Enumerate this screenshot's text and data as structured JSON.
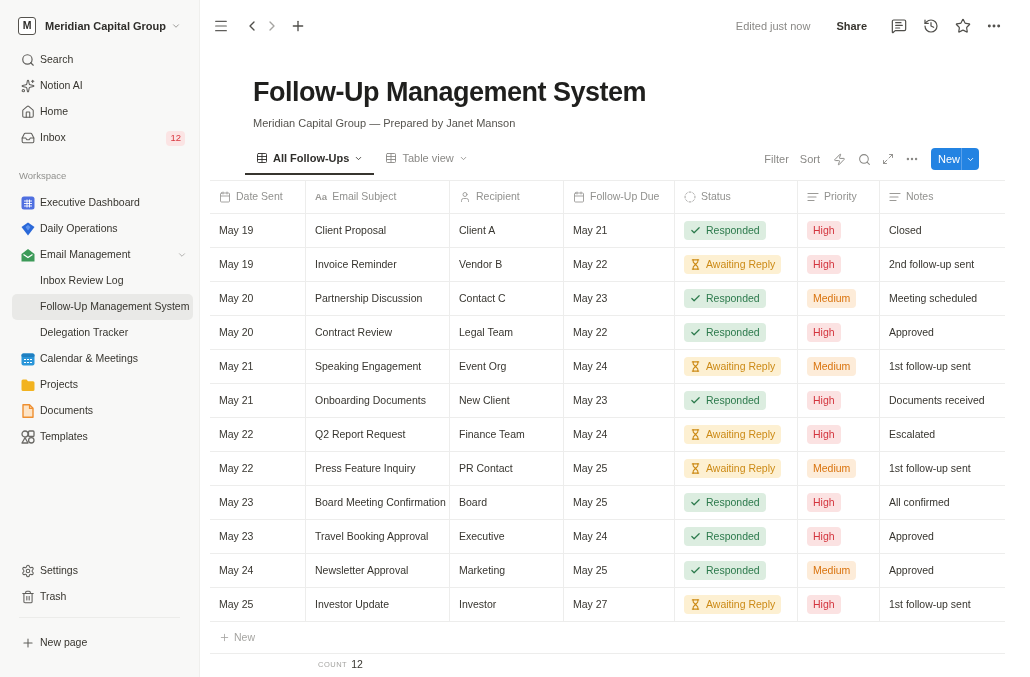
{
  "sidebar": {
    "workspace": {
      "initial": "M",
      "name": "Meridian Capital Group"
    },
    "nav": [
      {
        "label": "Search"
      },
      {
        "label": "Notion AI"
      },
      {
        "label": "Home"
      },
      {
        "label": "Inbox",
        "badge": "12"
      }
    ],
    "section_label": "Workspace",
    "pages": [
      {
        "label": "Executive Dashboard",
        "selected": false
      },
      {
        "label": "Daily Operations",
        "selected": false
      },
      {
        "label": "Email Management",
        "selected": false,
        "expanded": true,
        "children": [
          {
            "label": "Inbox Review Log",
            "selected": false
          },
          {
            "label": "Follow-Up Management System",
            "selected": true
          },
          {
            "label": "Delegation Tracker",
            "selected": false
          }
        ]
      },
      {
        "label": "Calendar & Meetings",
        "selected": false
      },
      {
        "label": "Projects",
        "selected": false
      },
      {
        "label": "Documents",
        "selected": false
      },
      {
        "label": "Templates",
        "selected": false
      }
    ],
    "footer": [
      {
        "label": "Settings"
      },
      {
        "label": "Trash"
      }
    ],
    "new_page": "New page"
  },
  "topbar": {
    "status": "Edited just now",
    "share": "Share"
  },
  "page": {
    "title": "Follow-Up Management System",
    "subtitle": "Meridian Capital Group — Prepared by Janet Manson"
  },
  "views": [
    {
      "label": "All Follow-Ups",
      "selected": true
    },
    {
      "label": "Table view",
      "selected": false
    }
  ],
  "toolbar": {
    "filter": "Filter",
    "sort": "Sort",
    "new_button": "New"
  },
  "table": {
    "columns": [
      {
        "label": "Date Sent"
      },
      {
        "label": "Email Subject",
        "glyph": "Aa"
      },
      {
        "label": "Recipient"
      },
      {
        "label": "Follow-Up Due"
      },
      {
        "label": "Status"
      },
      {
        "label": "Priority"
      },
      {
        "label": "Notes"
      }
    ],
    "rows": [
      {
        "date_sent": "May 19",
        "email_subject": "Client Proposal",
        "recipient": "Client A",
        "follow_up_due": "May 21",
        "status": {
          "label": "Responded",
          "kind": "responded"
        },
        "priority": {
          "label": "High",
          "kind": "high"
        },
        "notes": "Closed"
      },
      {
        "date_sent": "May 19",
        "email_subject": "Invoice Reminder",
        "recipient": "Vendor B",
        "follow_up_due": "May 22",
        "status": {
          "label": "Awaiting Reply",
          "kind": "awaiting"
        },
        "priority": {
          "label": "High",
          "kind": "high"
        },
        "notes": "2nd follow-up sent"
      },
      {
        "date_sent": "May 20",
        "email_subject": "Partnership Discussion",
        "recipient": "Contact C",
        "follow_up_due": "May 23",
        "status": {
          "label": "Responded",
          "kind": "responded"
        },
        "priority": {
          "label": "Medium",
          "kind": "medium"
        },
        "notes": "Meeting scheduled"
      },
      {
        "date_sent": "May 20",
        "email_subject": "Contract Review",
        "recipient": "Legal Team",
        "follow_up_due": "May 22",
        "status": {
          "label": "Responded",
          "kind": "responded"
        },
        "priority": {
          "label": "High",
          "kind": "high"
        },
        "notes": "Approved"
      },
      {
        "date_sent": "May 21",
        "email_subject": "Speaking Engagement",
        "recipient": "Event Org",
        "follow_up_due": "May 24",
        "status": {
          "label": "Awaiting Reply",
          "kind": "awaiting"
        },
        "priority": {
          "label": "Medium",
          "kind": "medium"
        },
        "notes": "1st follow-up sent"
      },
      {
        "date_sent": "May 21",
        "email_subject": "Onboarding Documents",
        "recipient": "New Client",
        "follow_up_due": "May 23",
        "status": {
          "label": "Responded",
          "kind": "responded"
        },
        "priority": {
          "label": "High",
          "kind": "high"
        },
        "notes": "Documents received"
      },
      {
        "date_sent": "May 22",
        "email_subject": "Q2 Report Request",
        "recipient": "Finance Team",
        "follow_up_due": "May 24",
        "status": {
          "label": "Awaiting Reply",
          "kind": "awaiting"
        },
        "priority": {
          "label": "High",
          "kind": "high"
        },
        "notes": "Escalated"
      },
      {
        "date_sent": "May 22",
        "email_subject": "Press Feature Inquiry",
        "recipient": "PR Contact",
        "follow_up_due": "May 25",
        "status": {
          "label": "Awaiting Reply",
          "kind": "awaiting"
        },
        "priority": {
          "label": "Medium",
          "kind": "medium"
        },
        "notes": "1st follow-up sent"
      },
      {
        "date_sent": "May 23",
        "email_subject": "Board Meeting Confirmation",
        "recipient": "Board",
        "follow_up_due": "May 25",
        "status": {
          "label": "Responded",
          "kind": "responded"
        },
        "priority": {
          "label": "High",
          "kind": "high"
        },
        "notes": "All confirmed"
      },
      {
        "date_sent": "May 23",
        "email_subject": "Travel Booking Approval",
        "recipient": "Executive",
        "follow_up_due": "May 24",
        "status": {
          "label": "Responded",
          "kind": "responded"
        },
        "priority": {
          "label": "High",
          "kind": "high"
        },
        "notes": "Approved"
      },
      {
        "date_sent": "May 24",
        "email_subject": "Newsletter Approval",
        "recipient": "Marketing",
        "follow_up_due": "May 25",
        "status": {
          "label": "Responded",
          "kind": "responded"
        },
        "priority": {
          "label": "Medium",
          "kind": "medium"
        },
        "notes": "Approved"
      },
      {
        "date_sent": "May 25",
        "email_subject": "Investor Update",
        "recipient": "Investor",
        "follow_up_due": "May 27",
        "status": {
          "label": "Awaiting Reply",
          "kind": "awaiting"
        },
        "priority": {
          "label": "High",
          "kind": "high"
        },
        "notes": "1st follow-up sent"
      }
    ],
    "new_row": "New",
    "count_label": "COUNT",
    "count": "12"
  }
}
